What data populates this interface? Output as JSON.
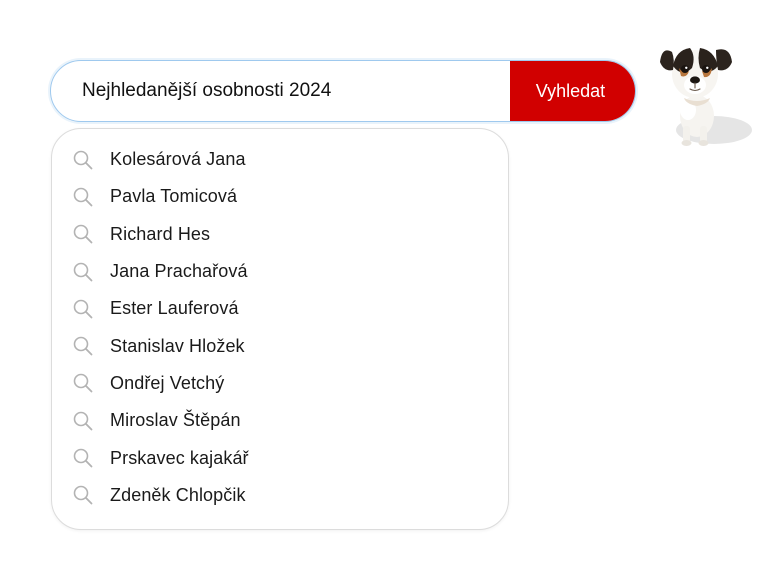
{
  "search": {
    "value": "Nejhledanější osobnosti 2024",
    "button_label": "Vyhledat"
  },
  "suggestions": [
    {
      "label": "Kolesárová Jana",
      "icon": "search-icon"
    },
    {
      "label": "Pavla Tomicová",
      "icon": "search-icon"
    },
    {
      "label": "Richard Hes",
      "icon": "search-icon"
    },
    {
      "label": "Jana Prachařová",
      "icon": "search-icon"
    },
    {
      "label": "Ester Lauferová",
      "icon": "search-icon"
    },
    {
      "label": "Stanislav Hložek",
      "icon": "search-icon"
    },
    {
      "label": "Ondřej Vetchý",
      "icon": "search-icon"
    },
    {
      "label": "Miroslav Štěpán",
      "icon": "search-icon"
    },
    {
      "label": "Prskavec kajakář",
      "icon": "search-icon"
    },
    {
      "label": "Zdeněk Chlopčik",
      "icon": "search-icon"
    }
  ],
  "colors": {
    "accent": "#d10000",
    "input_border": "#9fc9ee",
    "panel_border": "#dcdcdc"
  },
  "mascot": {
    "icon": "dog-mascot-icon"
  }
}
